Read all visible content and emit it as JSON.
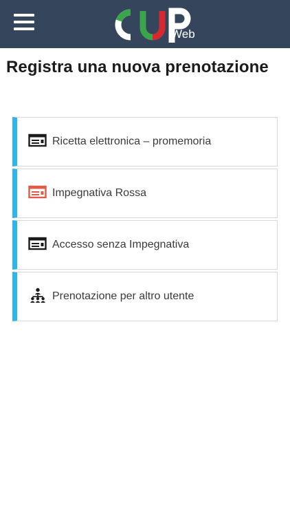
{
  "header": {
    "logo_text": "CUP",
    "logo_suffix": "Web",
    "colors": {
      "bar": "#35465c",
      "logo_green": "#3aa54a",
      "logo_red": "#d8282f",
      "logo_white": "#ffffff"
    }
  },
  "page": {
    "title": "Registra una nuova prenotazione"
  },
  "menu": {
    "accent_color": "#2fb6e6",
    "items": [
      {
        "label": "Ricetta elettronica – promemoria",
        "icon": "card-icon",
        "icon_color": "#1b1b1b"
      },
      {
        "label": "Impegnativa Rossa",
        "icon": "card-icon",
        "icon_color": "#e05a45"
      },
      {
        "label": "Accesso senza Impegnativa",
        "icon": "card-icon",
        "icon_color": "#1b1b1b"
      },
      {
        "label": "Prenotazione per altro utente",
        "icon": "users-hierarchy-icon",
        "icon_color": "#1b1b1b"
      }
    ]
  }
}
